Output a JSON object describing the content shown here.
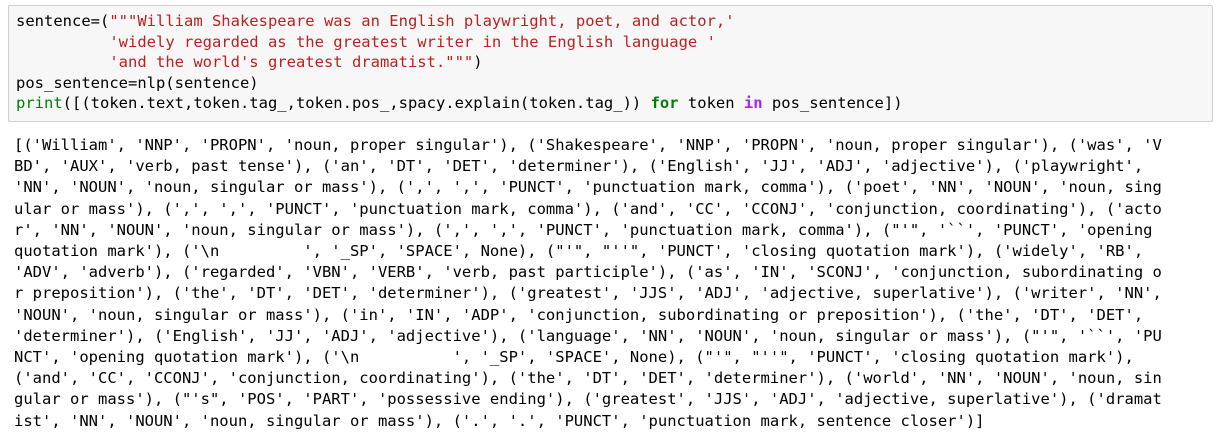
{
  "input_cell": {
    "lines": [
      {
        "prefix": "sentence=(",
        "string": "\"\"\"William Shakespeare was an English playwright, poet, and actor,'"
      },
      {
        "prefix": "          ",
        "string": "'widely regarded as the greatest writer in the English language '"
      },
      {
        "prefix": "          ",
        "string": "'and the world's greatest dramatist.\"\"\"",
        "suffix": ")"
      }
    ],
    "line4": "pos_sentence=nlp(sentence)",
    "line5": {
      "builtin": "print",
      "part1": "([(token.text,token.tag_,token.pos_,spacy.explain(token.tag_)) ",
      "kw_for": "for",
      "part2": " token ",
      "op_in": "in",
      "part3": " pos_sentence])"
    }
  },
  "output": {
    "lines": [
      "[('William', 'NNP', 'PROPN', 'noun, proper singular'), ('Shakespeare', 'NNP', 'PROPN', 'noun, proper singular'), ('was', 'V",
      "BD', 'AUX', 'verb, past tense'), ('an', 'DT', 'DET', 'determiner'), ('English', 'JJ', 'ADJ', 'adjective'), ('playwright',",
      "'NN', 'NOUN', 'noun, singular or mass'), (',', ',', 'PUNCT', 'punctuation mark, comma'), ('poet', 'NN', 'NOUN', 'noun, sing",
      "ular or mass'), (',', ',', 'PUNCT', 'punctuation mark, comma'), ('and', 'CC', 'CCONJ', 'conjunction, coordinating'), ('acto",
      "r', 'NN', 'NOUN', 'noun, singular or mass'), (',', ',', 'PUNCT', 'punctuation mark, comma'), (\"'\", '``', 'PUNCT', 'opening",
      "quotation mark'), ('\\n         ', '_SP', 'SPACE', None), (\"'\", \"''\", 'PUNCT', 'closing quotation mark'), ('widely', 'RB',",
      "'ADV', 'adverb'), ('regarded', 'VBN', 'VERB', 'verb, past participle'), ('as', 'IN', 'SCONJ', 'conjunction, subordinating o",
      "r preposition'), ('the', 'DT', 'DET', 'determiner'), ('greatest', 'JJS', 'ADJ', 'adjective, superlative'), ('writer', 'NN',",
      "'NOUN', 'noun, singular or mass'), ('in', 'IN', 'ADP', 'conjunction, subordinating or preposition'), ('the', 'DT', 'DET',",
      "'determiner'), ('English', 'JJ', 'ADJ', 'adjective'), ('language', 'NN', 'NOUN', 'noun, singular or mass'), (\"'\", '``', 'PU",
      "NCT', 'opening quotation mark'), ('\\n          ', '_SP', 'SPACE', None), (\"'\", \"''\", 'PUNCT', 'closing quotation mark'),",
      "('and', 'CC', 'CCONJ', 'conjunction, coordinating'), ('the', 'DT', 'DET', 'determiner'), ('world', 'NN', 'NOUN', 'noun, sin",
      "gular or mass'), (\"'s\", 'POS', 'PART', 'possessive ending'), ('greatest', 'JJS', 'ADJ', 'adjective, superlative'), ('dramat",
      "ist', 'NN', 'NOUN', 'noun, singular or mass'), ('.', '.', 'PUNCT', 'punctuation mark, sentence closer')]"
    ]
  }
}
